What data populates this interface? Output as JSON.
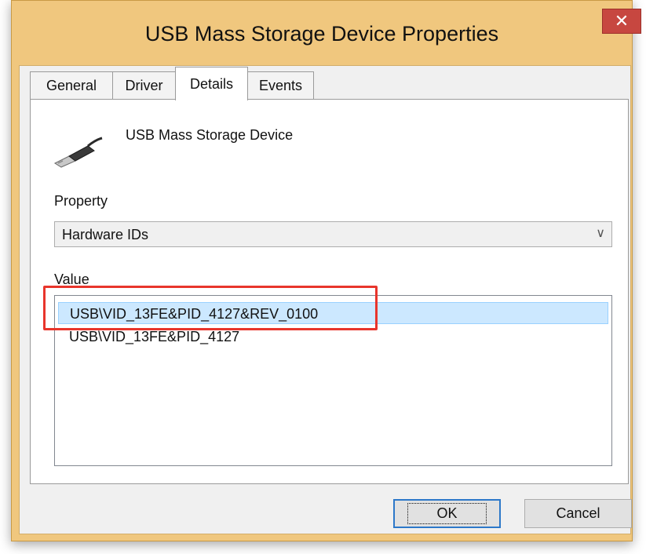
{
  "window": {
    "title": "USB Mass Storage Device Properties",
    "close_label": "✕"
  },
  "tabs": [
    {
      "label": "General",
      "active": false
    },
    {
      "label": "Driver",
      "active": false
    },
    {
      "label": "Details",
      "active": true
    },
    {
      "label": "Events",
      "active": false
    }
  ],
  "device": {
    "icon": "usb-plug-icon",
    "name": "USB Mass Storage Device"
  },
  "property": {
    "label": "Property",
    "selected": "Hardware IDs"
  },
  "value": {
    "label": "Value",
    "items": [
      "USB\\VID_13FE&PID_4127&REV_0100",
      "USB\\VID_13FE&PID_4127"
    ],
    "selected_index": 0
  },
  "buttons": {
    "ok_label": "OK",
    "cancel_label": "Cancel"
  },
  "colors": {
    "window_frame": "#f0c77e",
    "close_button": "#c74740",
    "selection": "#cce8ff",
    "annotation": "#e8352c"
  }
}
